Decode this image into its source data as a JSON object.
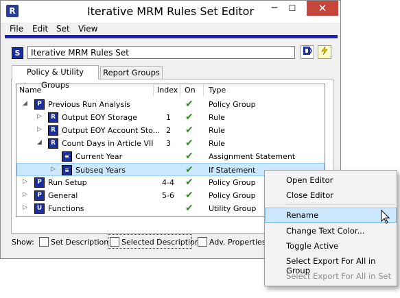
{
  "window": {
    "title": "Iterative MRM Rules Set Editor",
    "app_icon": "riverware-icon",
    "controls": {
      "minimize": "─",
      "maximize": "☐",
      "close": "✕"
    }
  },
  "menu": {
    "file": "File",
    "edit": "Edit",
    "set": "Set",
    "view": "View"
  },
  "set": {
    "badge": "S",
    "name": "Iterative MRM Rules Set"
  },
  "tabs": {
    "policy": "Policy & Utility Groups",
    "report": "Report Groups"
  },
  "tree": {
    "columns": {
      "name": "Name",
      "index": "Index",
      "on": "On",
      "type": "Type"
    },
    "rows": [
      {
        "expander": "◢",
        "icon": "P",
        "name": "Previous Run Analysis",
        "index": "",
        "on": true,
        "type": "Policy Group"
      },
      {
        "expander": "▷",
        "icon": "R",
        "name": "Output EOY Storage",
        "index": "1",
        "on": true,
        "type": "Rule"
      },
      {
        "expander": "▷",
        "icon": "R",
        "name": "Output EOY Account Sto...",
        "index": "2",
        "on": true,
        "type": "Rule"
      },
      {
        "expander": "◢",
        "icon": "R",
        "name": "Count Days in Article VII",
        "index": "3",
        "on": true,
        "type": "Rule"
      },
      {
        "expander": "",
        "icon": "≡",
        "name": "Current Year",
        "index": "",
        "on": true,
        "type": "Assignment Statement"
      },
      {
        "expander": "▷",
        "icon": "≡",
        "name": "Subseq Years",
        "index": "",
        "on": true,
        "type": "If Statement"
      },
      {
        "expander": "▷",
        "icon": "P",
        "name": "Run Setup",
        "index": "4-4",
        "on": true,
        "type": "Policy Group"
      },
      {
        "expander": "▷",
        "icon": "P",
        "name": "General",
        "index": "5-6",
        "on": true,
        "type": "Policy Group"
      },
      {
        "expander": "▷",
        "icon": "U",
        "name": "Functions",
        "index": "",
        "on": true,
        "type": "Utility Group"
      }
    ],
    "check_glyph": "✔"
  },
  "show": {
    "label": "Show:",
    "set_description": "Set Description",
    "selected_description": "Selected Description",
    "adv_properties": "Adv. Properties"
  },
  "context_menu": {
    "open_editor": "Open Editor",
    "close_editor": "Close Editor",
    "rename": "Rename",
    "change_text_color": "Change Text Color...",
    "toggle_active": "Toggle Active",
    "select_export_group": "Select Export For All in Group",
    "select_export_set": "Select Export For All in Set"
  },
  "colors": {
    "accent_rule": "#1c24b8",
    "badge": "#1a2f9c",
    "check": "#2e8b1e",
    "close_button": "#c7463c",
    "selection": "#cce8ff"
  }
}
